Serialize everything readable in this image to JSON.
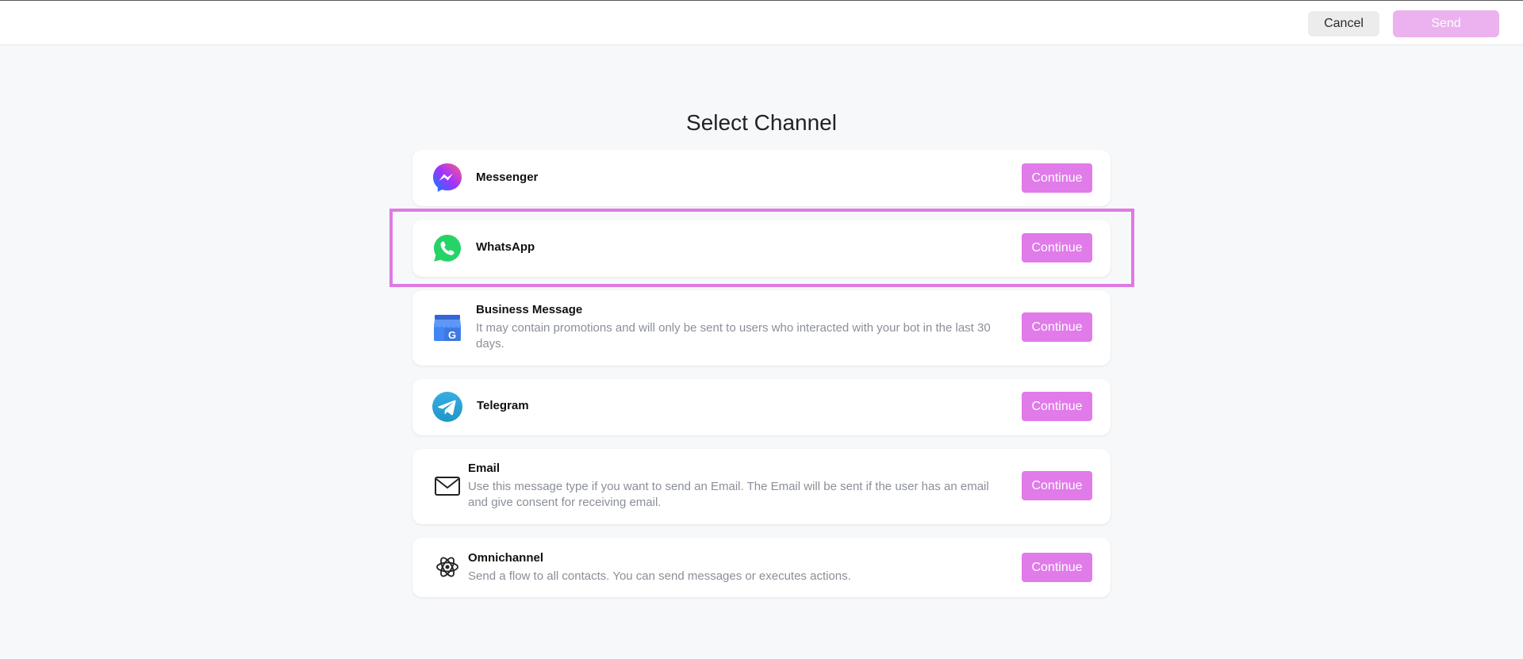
{
  "topbar": {
    "cancel_label": "Cancel",
    "send_label": "Send"
  },
  "page": {
    "title": "Select Channel"
  },
  "channels": [
    {
      "name": "Messenger",
      "description": "",
      "continue_label": "Continue",
      "icon": "messenger-icon"
    },
    {
      "name": "WhatsApp",
      "description": "",
      "continue_label": "Continue",
      "icon": "whatsapp-icon"
    },
    {
      "name": "Business Message",
      "description": "It may contain promotions and will only be sent to users who interacted with your bot in the last 30 days.",
      "continue_label": "Continue",
      "icon": "google-business-icon"
    },
    {
      "name": "Telegram",
      "description": "",
      "continue_label": "Continue",
      "icon": "telegram-icon"
    },
    {
      "name": "Email",
      "description": "Use this message type if you want to send an Email. The Email will be sent if the user has an email and give consent for receiving email.",
      "continue_label": "Continue",
      "icon": "envelope-icon"
    },
    {
      "name": "Omnichannel",
      "description": "Send a flow to all contacts. You can send messages or executes actions.",
      "continue_label": "Continue",
      "icon": "atom-icon"
    }
  ],
  "colors": {
    "accent": "#e07be9",
    "send_disabled": "#ebb2ef",
    "highlight_border": "#de7ae4",
    "background": "#f7f8fa"
  }
}
